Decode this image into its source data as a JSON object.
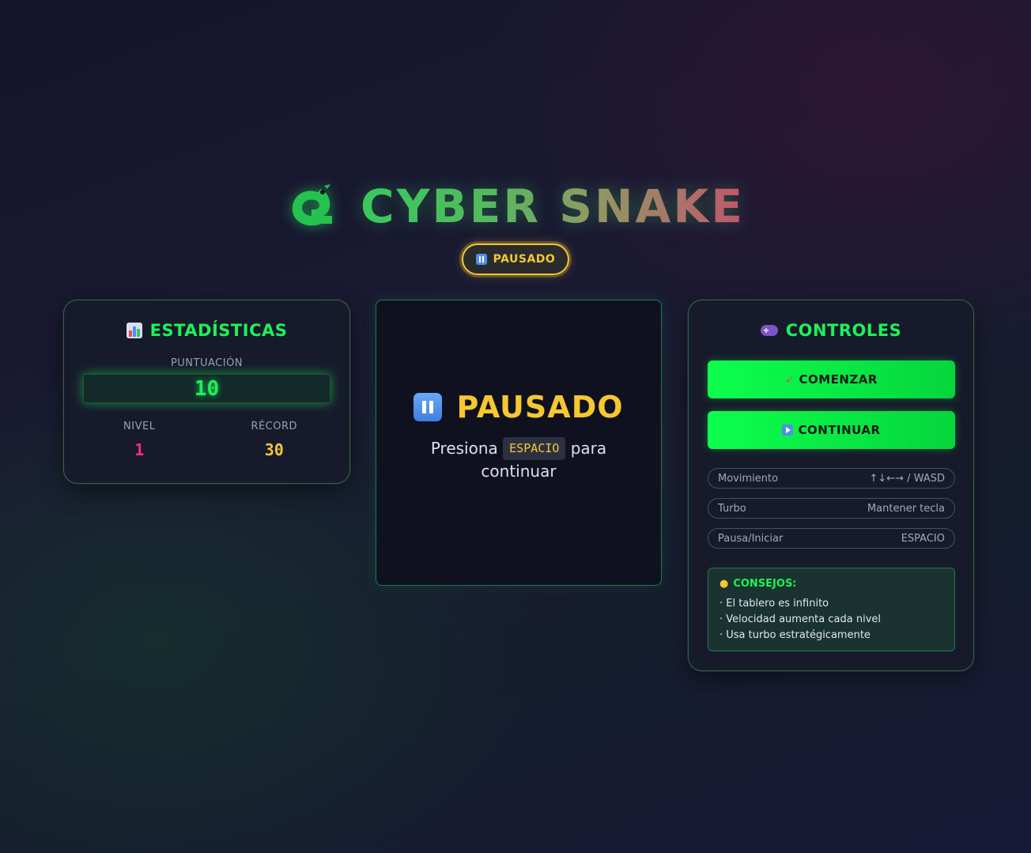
{
  "header": {
    "title": "CYBER SNAKE",
    "status": "PAUSADO"
  },
  "stats": {
    "title": "ESTADÍSTICAS",
    "score_label": "PUNTUACIÓN",
    "score": "10",
    "level_label": "NIVEL",
    "level": "1",
    "record_label": "RÉCORD",
    "record": "30"
  },
  "board": {
    "overlay_title": "PAUSADO",
    "press_before": "Presiona",
    "key": "ESPACIO",
    "press_after": "para continuar"
  },
  "controls": {
    "title": "CONTROLES",
    "start_label": "COMENZAR",
    "continue_label": "CONTINUAR",
    "rows": [
      {
        "action": "Movimiento",
        "key": "↑↓←→ / WASD"
      },
      {
        "action": "Turbo",
        "key": "Mantener tecla"
      },
      {
        "action": "Pausa/Iniciar",
        "key": "ESPACIO"
      }
    ],
    "tips_title": "CONSEJOS:",
    "tips": [
      "· El tablero es infinito",
      "· Velocidad aumenta cada nivel",
      "· Usa turbo estratégicamente"
    ]
  },
  "colors": {
    "accent_green": "#1df25a",
    "paused_yellow": "#f5c830",
    "level_pink": "#ff2d7a",
    "panel_bg": "#171a2b"
  },
  "icons": [
    "snake-icon",
    "pause-icon",
    "chart-icon",
    "gamepad-icon",
    "rocket-icon",
    "play-icon",
    "bulb-icon"
  ]
}
